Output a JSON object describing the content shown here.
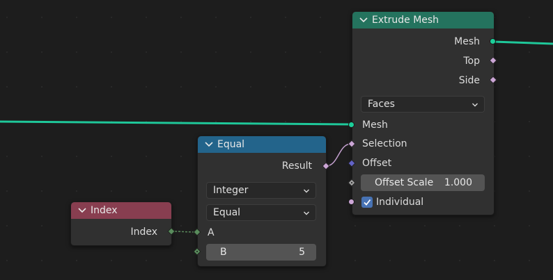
{
  "nodes": {
    "extrude": {
      "title": "Extrude Mesh",
      "header_color": "#24735e",
      "outputs": [
        "Mesh",
        "Top",
        "Side"
      ],
      "mode": "Faces",
      "inputs": {
        "mesh": "Mesh",
        "selection": "Selection",
        "offset": "Offset",
        "offset_scale_label": "Offset Scale",
        "offset_scale_value": "1.000",
        "individual_label": "Individual",
        "individual_checked": true
      }
    },
    "equal": {
      "title": "Equal",
      "header_color": "#23648b",
      "output": "Result",
      "data_type": "Integer",
      "operation": "Equal",
      "input_a": "A",
      "input_b_label": "B",
      "input_b_value": "5"
    },
    "index": {
      "title": "Index",
      "header_color": "#883e50",
      "output": "Index"
    }
  },
  "colors": {
    "geometry_socket": "#1ccf9a",
    "boolean_socket": "#cca6d6",
    "vector_socket": "#6363c7",
    "integer_socket": "#598c5c",
    "float_socket": "#a1a1a1",
    "geometry_link": "#1fc89a"
  }
}
